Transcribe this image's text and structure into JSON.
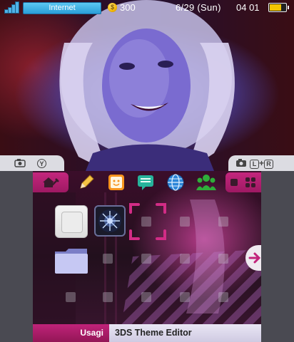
{
  "status_bar": {
    "network_label": "Internet",
    "coin_symbol": "$",
    "coin_count": "300",
    "date": "6/29 (Sun)",
    "time": "04 01",
    "battery_level": 0.75
  },
  "divider": {
    "left_tab": {
      "camera_icon": "camera-icon",
      "button_glyph": "Y"
    },
    "right_tab": {
      "camera_icon": "camera-icon",
      "label": "L+R",
      "l_glyph": "L",
      "plus": "+",
      "r_glyph": "R"
    }
  },
  "toolbar": {
    "icons": [
      "home-settings-icon",
      "pencil-icon",
      "miiverse-face-icon",
      "speech-bubble-icon",
      "internet-globe-icon",
      "friends-icon",
      "small-square-icon",
      "grid-icon"
    ]
  },
  "home_grid": {
    "apps": [
      "blank-app-icon",
      "starburst-app-icon",
      "folder-icon"
    ],
    "scroll_arrow_icon": "arrow-right-icon"
  },
  "name_bar": {
    "left_label": "Usagi",
    "right_label": "3DS Theme Editor"
  },
  "colors": {
    "accent": "#b82070",
    "status_blue": "#2a9ed8"
  }
}
